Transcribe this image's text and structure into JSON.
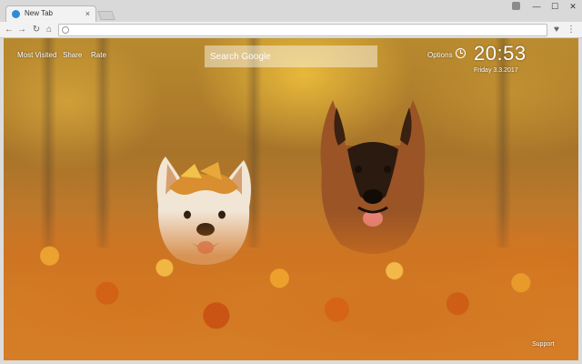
{
  "browser": {
    "tab_title": "New Tab",
    "tab_close": "×",
    "window": {
      "minimize": "—",
      "maximize": "☐",
      "close": "✕"
    },
    "nav": {
      "back": "←",
      "forward": "→",
      "reload": "↻",
      "home": "⌂"
    },
    "address": {
      "value": "",
      "placeholder": ""
    },
    "icons": {
      "extension": "♥",
      "menu": "⋮"
    }
  },
  "page": {
    "links": {
      "most_visited": "Most Visited",
      "share": "Share",
      "rate": "Rate"
    },
    "search": {
      "placeholder": "Search Google"
    },
    "options_label": "Options",
    "clock": {
      "time": "20:53",
      "date": "Friday  3.3.2017"
    },
    "support_label": "Support"
  },
  "colors": {
    "favicon": "#2f8bd8",
    "chrome": "#d9d9d9",
    "toolbar": "#f2f2f2"
  }
}
